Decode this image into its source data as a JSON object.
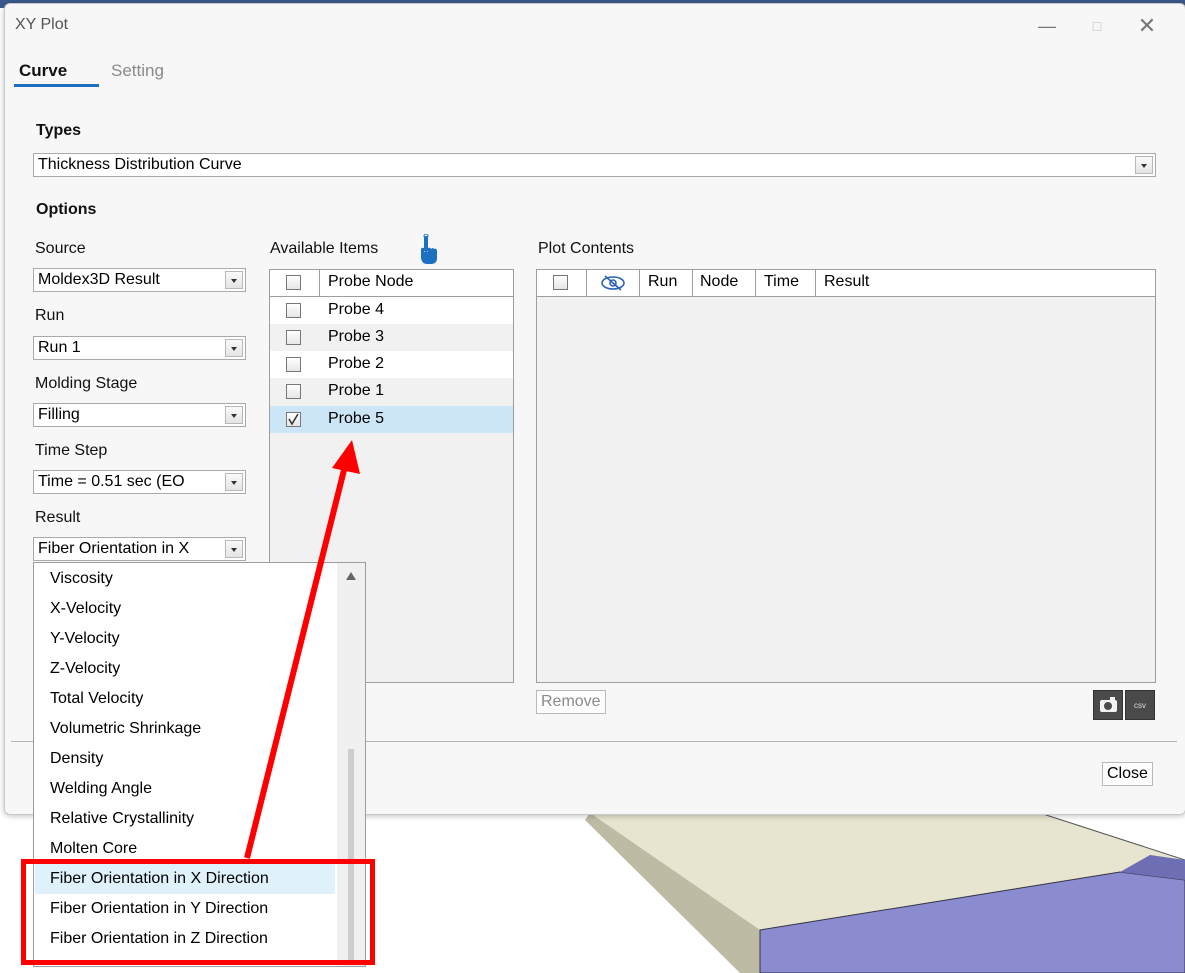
{
  "window": {
    "title": "XY Plot"
  },
  "tabs": [
    {
      "label": "Curve",
      "active": true
    },
    {
      "label": "Setting",
      "active": false
    }
  ],
  "types": {
    "label": "Types",
    "value": "Thickness Distribution Curve"
  },
  "options": {
    "label": "Options",
    "source": {
      "label": "Source",
      "value": "Moldex3D Result"
    },
    "run": {
      "label": "Run",
      "value": "Run 1"
    },
    "molding_stage": {
      "label": "Molding Stage",
      "value": "Filling"
    },
    "time_step": {
      "label": "Time Step",
      "value": "Time = 0.51 sec (EO"
    },
    "result": {
      "label": "Result",
      "value": "Fiber Orientation in X"
    }
  },
  "available_items": {
    "label": "Available Items",
    "header": "Probe Node",
    "rows": [
      {
        "label": "Probe 4",
        "checked": false
      },
      {
        "label": "Probe 3",
        "checked": false
      },
      {
        "label": "Probe 2",
        "checked": false
      },
      {
        "label": "Probe 1",
        "checked": false
      },
      {
        "label": "Probe 5",
        "checked": true
      }
    ]
  },
  "plot_contents": {
    "label": "Plot Contents",
    "columns": [
      "Run",
      "Node",
      "Time",
      "Result"
    ],
    "remove_label": "Remove",
    "csv_label": "csv"
  },
  "footer": {
    "close_label": "Close"
  },
  "result_dropdown": {
    "items": [
      "Viscosity",
      "X-Velocity",
      "Y-Velocity",
      "Z-Velocity",
      "Total Velocity",
      "Volumetric Shrinkage",
      "Density",
      "Welding Angle",
      "Relative Crystallinity",
      "Molten Core",
      "Fiber Orientation in X Direction",
      "Fiber Orientation in Y Direction",
      "Fiber Orientation in Z Direction"
    ],
    "selected": "Fiber Orientation in X Direction"
  },
  "colors": {
    "accent": "#1e6fbf",
    "annotation": "#ff0000",
    "selection": "#cde6f7",
    "model": "#8b8bd0"
  }
}
